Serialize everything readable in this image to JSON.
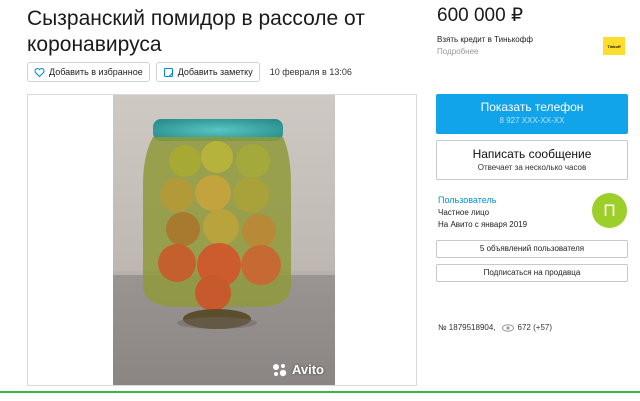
{
  "listing": {
    "title": "Сызранский помидор в рассоле от коронавируса",
    "favorite_label": "Добавить в избранное",
    "note_label": "Добавить заметку",
    "date": "10 февраля в 13:06",
    "photo_watermark": "Avito",
    "price": "600 000 ₽",
    "credit_text": "Взять кредит в Тинькофф",
    "credit_more": "Подробнее",
    "credit_logo": "Tinkoff",
    "listing_number": "№ 1879518904,",
    "views": "672 (+57)"
  },
  "contact": {
    "phone_button": "Показать телефон",
    "phone_masked": "8 927 XXX-XX-XX",
    "message_button": "Написать сообщение",
    "message_sub": "Отвечает за несколько часов"
  },
  "seller": {
    "name": "Пользователь",
    "type": "Частное лицо",
    "since": "На Авито с января 2019",
    "avatar_letter": "П",
    "ads_button": "5 объявлений пользователя",
    "subscribe_button": "Подписаться на продавца"
  },
  "colors": {
    "accent_blue": "#12a4ea",
    "avatar_green": "#9ccf2a",
    "tinkoff_yellow": "#ffdd2d",
    "link_blue": "#0091d9"
  },
  "icons": [
    "heart-icon",
    "note-icon",
    "eye-icon",
    "avito-logo-icon"
  ]
}
